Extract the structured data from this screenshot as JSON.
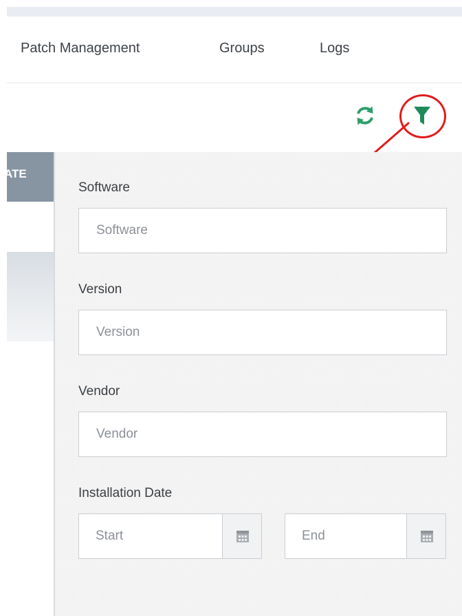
{
  "tabs": [
    {
      "label": "Patch Management"
    },
    {
      "label": "Groups"
    },
    {
      "label": "Logs"
    }
  ],
  "toolbar": {
    "refresh_icon": "refresh-icon",
    "filter_icon": "filter-icon",
    "accent_color": "#2e9e6b",
    "annotation_color": "#e21b1b"
  },
  "table": {
    "column_header_label": "ATE",
    "header_color": "#8795a3"
  },
  "filter": {
    "software": {
      "label": "Software",
      "placeholder": "Software"
    },
    "version": {
      "label": "Version",
      "placeholder": "Version"
    },
    "vendor": {
      "label": "Vendor",
      "placeholder": "Vendor"
    },
    "installation_date": {
      "label": "Installation Date",
      "start_placeholder": "Start",
      "end_placeholder": "End",
      "calendar_icon": "calendar-icon"
    }
  }
}
